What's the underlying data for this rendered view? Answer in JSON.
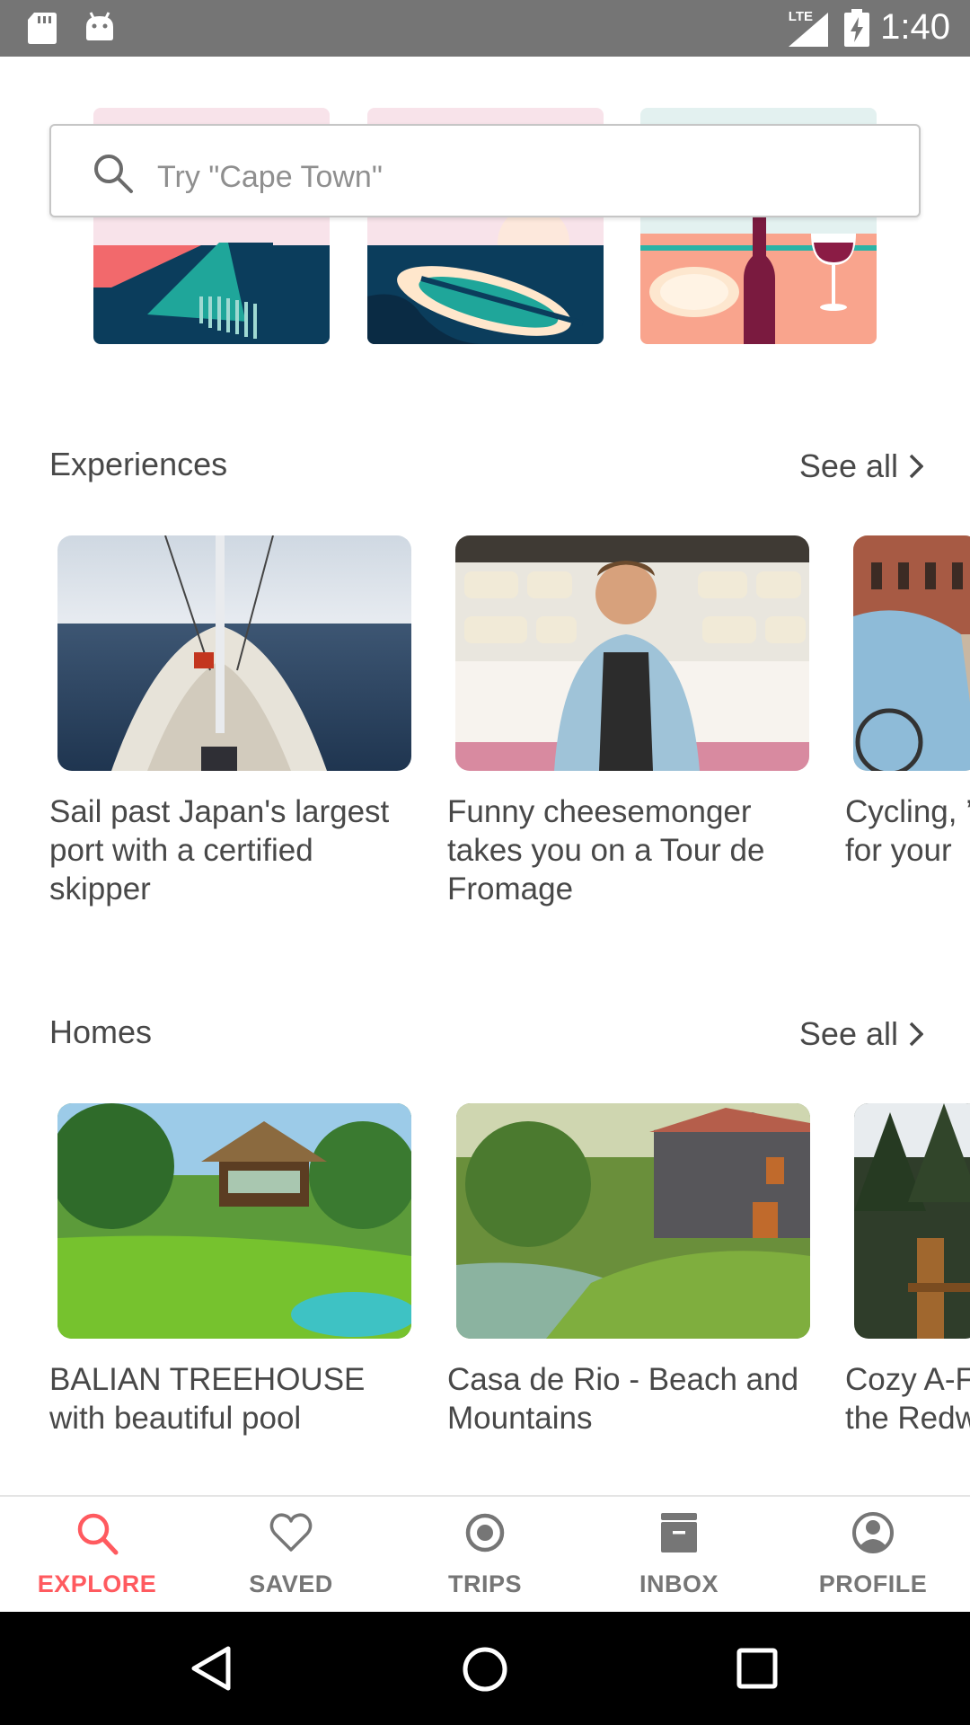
{
  "status_bar": {
    "time": "1:40",
    "network": "LTE",
    "icons": [
      "sd-card-icon",
      "android-icon",
      "signal-icon",
      "battery-charging-icon"
    ]
  },
  "search": {
    "placeholder": "Try \"Cape Town\""
  },
  "categories": [
    {
      "icon": "hotel-balcony-illustration"
    },
    {
      "icon": "boat-illustration"
    },
    {
      "icon": "wine-dinner-illustration"
    }
  ],
  "experiences": {
    "title": "Experiences",
    "see_all": "See all",
    "cards": [
      {
        "title": "Sail past Japan's largest port with a certified skipper",
        "image": "sailboat-photo"
      },
      {
        "title": "Funny cheesemonger takes you on a Tour de Fromage",
        "image": "cheesemonger-photo"
      },
      {
        "title": "Cycling, … for your",
        "image": "cycling-photo"
      }
    ]
  },
  "homes": {
    "title": "Homes",
    "see_all": "See all",
    "cards": [
      {
        "title": "BALIAN TREEHOUSE with beautiful pool",
        "image": "treehouse-photo"
      },
      {
        "title": "Casa de Rio - Beach and Mountains",
        "image": "stone-house-photo"
      },
      {
        "title": "Cozy A-F… the Redw…",
        "image": "redwood-photo"
      }
    ]
  },
  "bottom_nav": {
    "active": "EXPLORE",
    "items": [
      {
        "label": "EXPLORE",
        "icon": "search-icon"
      },
      {
        "label": "SAVED",
        "icon": "heart-icon"
      },
      {
        "label": "TRIPS",
        "icon": "trips-icon"
      },
      {
        "label": "INBOX",
        "icon": "inbox-icon"
      },
      {
        "label": "PROFILE",
        "icon": "profile-icon"
      }
    ]
  },
  "colors": {
    "accent": "#ff5a5f",
    "text": "#484848",
    "nav_inactive": "#767676",
    "status_bar": "#757575"
  }
}
